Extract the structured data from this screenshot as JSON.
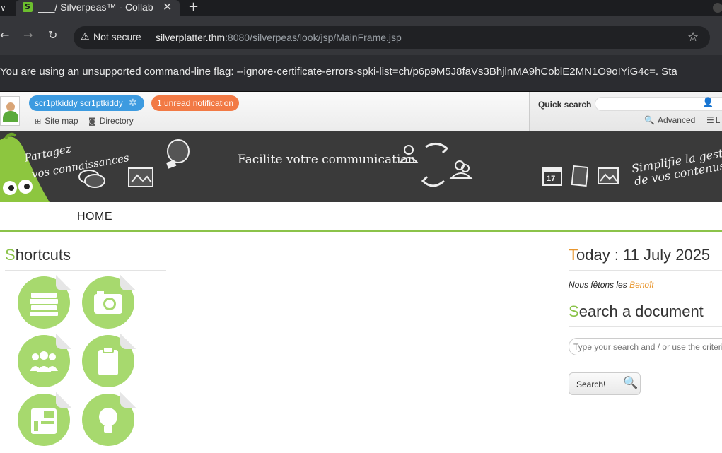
{
  "browser": {
    "tab_title": "___/ Silverpeas™ - Collab",
    "tab_favicon": "S",
    "tab_close": "✕",
    "new_tab": "+",
    "tab_menu_arrow": "∨",
    "back": "←",
    "forward": "→",
    "reload": "↻",
    "security_icon": "⚠",
    "security_label": "Not secure",
    "url_host": "silverplatter.thm",
    "url_path": ":8080/silverpeas/look/jsp/MainFrame.jsp",
    "bookmark_star": "☆",
    "infobar_message": "You are using an unsupported command-line flag: --ignore-certificate-errors-spki-list=ch/p6p9M5J8faVs3BhjlnMA9hCoblE2MN1O9oIYiG4c=. Sta"
  },
  "topbar": {
    "user_name": "scr1ptkiddy scr1ptkiddy",
    "user_gear": "✲",
    "notification": "1 unread notification",
    "site_map_icon": "⊞",
    "site_map": "Site map",
    "directory_icon": "◙",
    "directory": "Directory",
    "quick_search_label": "Quick search",
    "quick_search_user_icon": "👤",
    "advanced_icon": "🔍",
    "advanced": "Advanced",
    "list_icon": "☰",
    "list_label": "L"
  },
  "banner": {
    "left_text_1": "Partagez",
    "left_text_2": "vos connaissances",
    "center_text": "Facilite votre communication",
    "right_text_1": "Simplifie la gestion",
    "right_text_2": "de vos contenus",
    "calendar_day": "17"
  },
  "menu": {
    "home": "HOME"
  },
  "shortcuts": {
    "title_first": "S",
    "title_rest": "hortcuts"
  },
  "today": {
    "title_first": "T",
    "title_rest": "oday : 11 July 2025",
    "fetons_prefix": "Nous fêtons les",
    "fetons_name": "Benoît"
  },
  "search": {
    "title_first": "S",
    "title_rest": "earch a document",
    "placeholder": "Type your search and / or use the criteri",
    "button": "Search!",
    "button_icon": "🔍"
  },
  "colors": {
    "accent_green": "#8bc34a",
    "accent_orange": "#e8962e",
    "user_pill": "#3d9be0",
    "notification_pill": "#f27a45",
    "banner_bg": "#3a3a3a"
  }
}
